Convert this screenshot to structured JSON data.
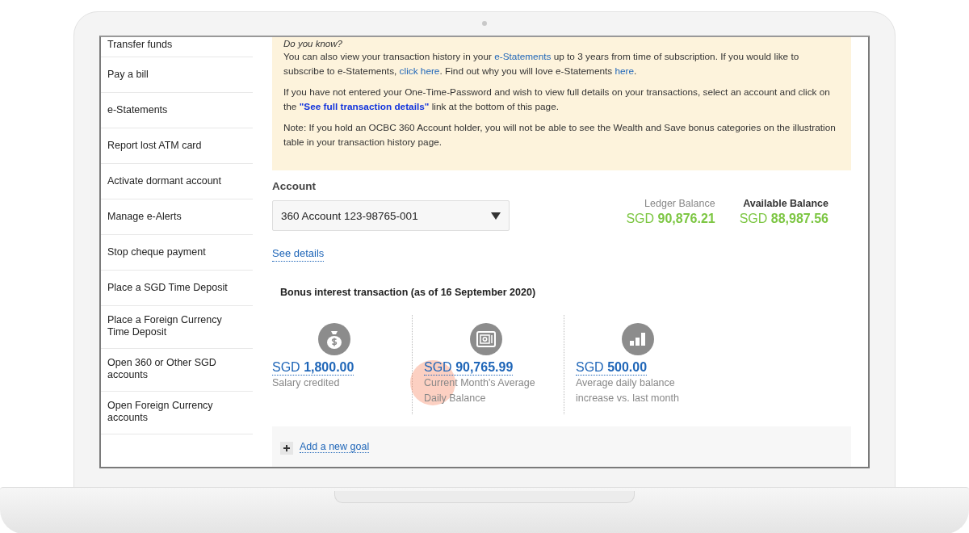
{
  "sidebar": {
    "items": [
      {
        "label": "Transfer funds"
      },
      {
        "label": "Pay a bill"
      },
      {
        "label": "e-Statements"
      },
      {
        "label": "Report lost ATM card"
      },
      {
        "label": "Activate dormant account"
      },
      {
        "label": "Manage e-Alerts"
      },
      {
        "label": "Stop cheque payment"
      },
      {
        "label": "Place a SGD Time Deposit"
      },
      {
        "label": "Place a Foreign Currency Time Deposit"
      },
      {
        "label": "Open 360 or Other SGD accounts"
      },
      {
        "label": "Open Foreign Currency accounts"
      }
    ]
  },
  "notice": {
    "heading": "Do you know?",
    "paragraphs": [
      [
        {
          "text": "You can also view your transaction history in your "
        },
        {
          "text": "e-Statements",
          "kind": "link"
        },
        {
          "text": " up to 3 years from time of subscription. If you would like to subscribe to e-Statements, "
        },
        {
          "text": "click here",
          "kind": "link"
        },
        {
          "text": ". Find out why you will love e-Statements "
        },
        {
          "text": "here",
          "kind": "link"
        },
        {
          "text": "."
        }
      ],
      [
        {
          "text": "If you have not entered your One-Time-Password and wish to view full details on your transactions, select an account and click on the "
        },
        {
          "text": "\"See full transaction details\"",
          "kind": "strong-link"
        },
        {
          "text": " link at the bottom of this page."
        }
      ],
      [
        {
          "text": "Note: If you hold an OCBC 360 Account holder, you will not be able to see the Wealth and Save bonus categories on the illustration table in your transaction history page."
        }
      ]
    ]
  },
  "account": {
    "label": "Account",
    "selected_value": "360 Account 123-98765-001",
    "details_link": "See details",
    "balances": [
      {
        "label": "Ledger Balance",
        "currency": "SGD",
        "amount": "90,876.21",
        "emphasis": false
      },
      {
        "label": "Available Balance",
        "currency": "SGD",
        "amount": "88,987.56",
        "emphasis": true
      }
    ]
  },
  "bonus": {
    "title": "Bonus interest transaction (as of 16 September 2020)",
    "items": [
      {
        "kind": "moneybag",
        "currency": "SGD",
        "amount": "1,800.00",
        "caption": "Salary credited"
      },
      {
        "kind": "safe",
        "currency": "SGD",
        "amount": "90,765.99",
        "caption": "Current Month's Average Daily Balance"
      },
      {
        "kind": "growth",
        "currency": "SGD",
        "amount": "500.00",
        "caption": "Average daily balance increase vs. last month"
      }
    ]
  },
  "add_goal": {
    "label": "Add a new goal"
  }
}
